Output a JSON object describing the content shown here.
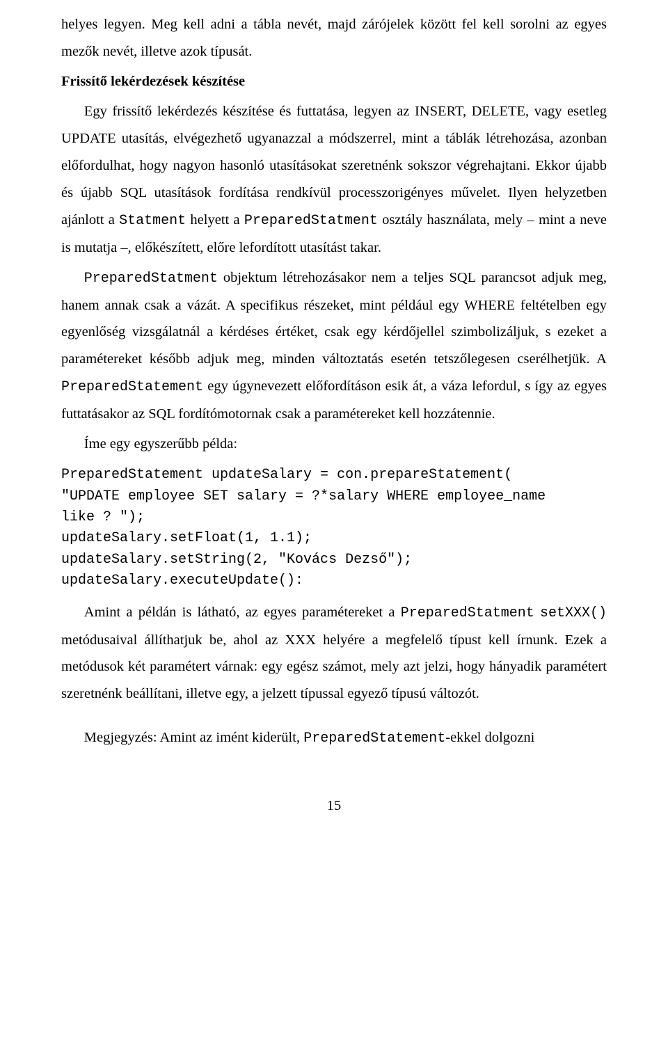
{
  "paragraphs": {
    "p1": "helyes legyen. Meg kell adni a tábla nevét, majd zárójelek között fel kell sorolni az egyes mezők nevét, illetve azok típusát.",
    "heading1": "Frissítő lekérdezések készítése",
    "p2_a": "Egy frissítő lekérdezés készítése és futtatása, legyen az INSERT, DELETE, vagy esetleg UPDATE utasítás, elvégezhető ugyanazzal a módszerrel, mint a táblák létrehozása, azonban előfordulhat, hogy nagyon hasonló utasításokat szeretnénk sokszor végrehajtani. Ekkor újabb és újabb SQL utasítások fordítása rendkívül processzorigényes művelet. Ilyen helyzetben ajánlott a ",
    "p2_code1": "Statment",
    "p2_b": " helyett a ",
    "p2_code2": "PreparedStatment",
    "p2_c": " osztály használata, mely – mint a neve is mutatja –, előkészített, előre lefordított utasítást takar.",
    "p3_code1": "PreparedStatment",
    "p3_a": " objektum létrehozásakor nem a teljes SQL parancsot adjuk meg, hanem annak csak a vázát. A specifikus részeket, mint például egy WHERE feltételben egy egyenlőség vizsgálatnál a kérdéses értéket, csak egy kérdőjellel szimbolizáljuk, s ezeket a paramétereket később adjuk meg, minden változtatás esetén tetszőlegesen cserélhetjük. A ",
    "p3_code2": "PreparedStatement",
    "p3_b": " egy úgynevezett előfordításon esik át, a váza lefordul, s így az egyes futtatásakor az SQL fordítómotornak csak a paramétereket kell hozzátennie.",
    "p4": "Íme egy egyszerűbb példa:",
    "p5_a": "Amint a példán is látható, az egyes paramétereket a ",
    "p5_code1": "PreparedStatment",
    "p5_b": " ",
    "p5_code2": "setXXX()",
    "p5_c": " metódusaival állíthatjuk be, ahol az XXX helyére a megfelelő típust kell írnunk. Ezek a metódusok két paramétert várnak: egy egész számot, mely azt jelzi, hogy hányadik paramétert szeretnénk beállítani, illetve egy, a jelzett típussal egyező típusú változót.",
    "p6_a": "Megjegyzés: Amint az imént kiderült, ",
    "p6_code1": "PreparedStatement",
    "p6_b": "-ekkel dolgozni"
  },
  "code": {
    "block1": "PreparedStatement updateSalary = con.prepareStatement(\n\"UPDATE employee SET salary = ?*salary WHERE employee_name\nlike ? \");\nupdateSalary.setFloat(1, 1.1);\nupdateSalary.setString(2, \"Kovács Dezső\");\nupdateSalary.executeUpdate():"
  },
  "pageNumber": "15"
}
